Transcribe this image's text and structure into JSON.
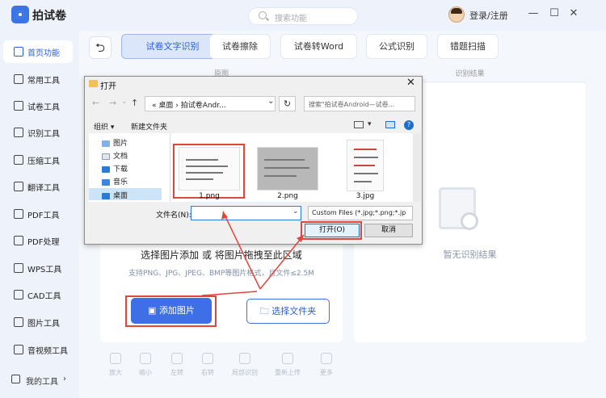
{
  "app": {
    "name": "拍试卷",
    "brand_color": "#3f6fe6"
  },
  "header": {
    "search_placeholder": "搜索功能",
    "login": "登录/注册",
    "minimize": "—",
    "maximize": "☐",
    "close": "✕"
  },
  "sidebar": {
    "items": [
      {
        "label": "首页功能",
        "icon": "home-icon",
        "active": true
      },
      {
        "label": "常用工具",
        "icon": "layers-icon"
      },
      {
        "label": "试卷工具",
        "icon": "paper-icon"
      },
      {
        "label": "识别工具",
        "icon": "scan-icon"
      },
      {
        "label": "压缩工具",
        "icon": "compress-icon"
      },
      {
        "label": "翻译工具",
        "icon": "translate-icon"
      },
      {
        "label": "PDF工具",
        "icon": "pdf-icon"
      },
      {
        "label": "PDF处理",
        "icon": "pdf-process-icon"
      },
      {
        "label": "WPS工具",
        "icon": "wps-icon"
      },
      {
        "label": "CAD工具",
        "icon": "cad-icon"
      },
      {
        "label": "图片工具",
        "icon": "image-icon"
      },
      {
        "label": "音视频工具",
        "icon": "media-icon"
      }
    ],
    "my_tools": "我的工具"
  },
  "main": {
    "back": "⮌",
    "tabs": [
      {
        "label": "试卷文字识别",
        "active": true
      },
      {
        "label": "试卷擦除"
      },
      {
        "label": "试卷转Word"
      },
      {
        "label": "公式识别"
      },
      {
        "label": "错题扫描"
      }
    ],
    "left_header": "原图",
    "right_header": "识别结果",
    "drop_title": "选择图片添加 或 将图片拖拽至此区域",
    "drop_subtitle": "支持PNG、JPG、JPEG、BMP等图片格式，且文件≤2.5M",
    "add_image": "添加图片",
    "choose_folder": "选择文件夹",
    "empty_result": "暂无识别结果",
    "toolbar": [
      "放大",
      "缩小",
      "左转",
      "右转",
      "局部识别",
      "重新上传",
      "更多"
    ]
  },
  "dialog": {
    "title": "打开",
    "close": "✕",
    "address": "« 桌面  › 拍试卷Andr...",
    "address_dropdown": "⌄",
    "refresh": "↻",
    "search_placeholder": "搜索\"拍试卷Android—试卷...",
    "organize": "组织 ▾",
    "new_folder": "新建文件夹",
    "nav_items": [
      "图片",
      "文档",
      "下载",
      "音乐",
      "桌面"
    ],
    "files": [
      "1.png",
      "2.png",
      "3.jpg"
    ],
    "filename_label": "文件名(N):",
    "filename_value": "",
    "filter": "Custom Files (*.jpg;*.png;*.jp",
    "open": "打开(O)",
    "cancel": "取消"
  },
  "colors": {
    "highlight": "#e0473a",
    "accent": "#3f6fe6"
  }
}
